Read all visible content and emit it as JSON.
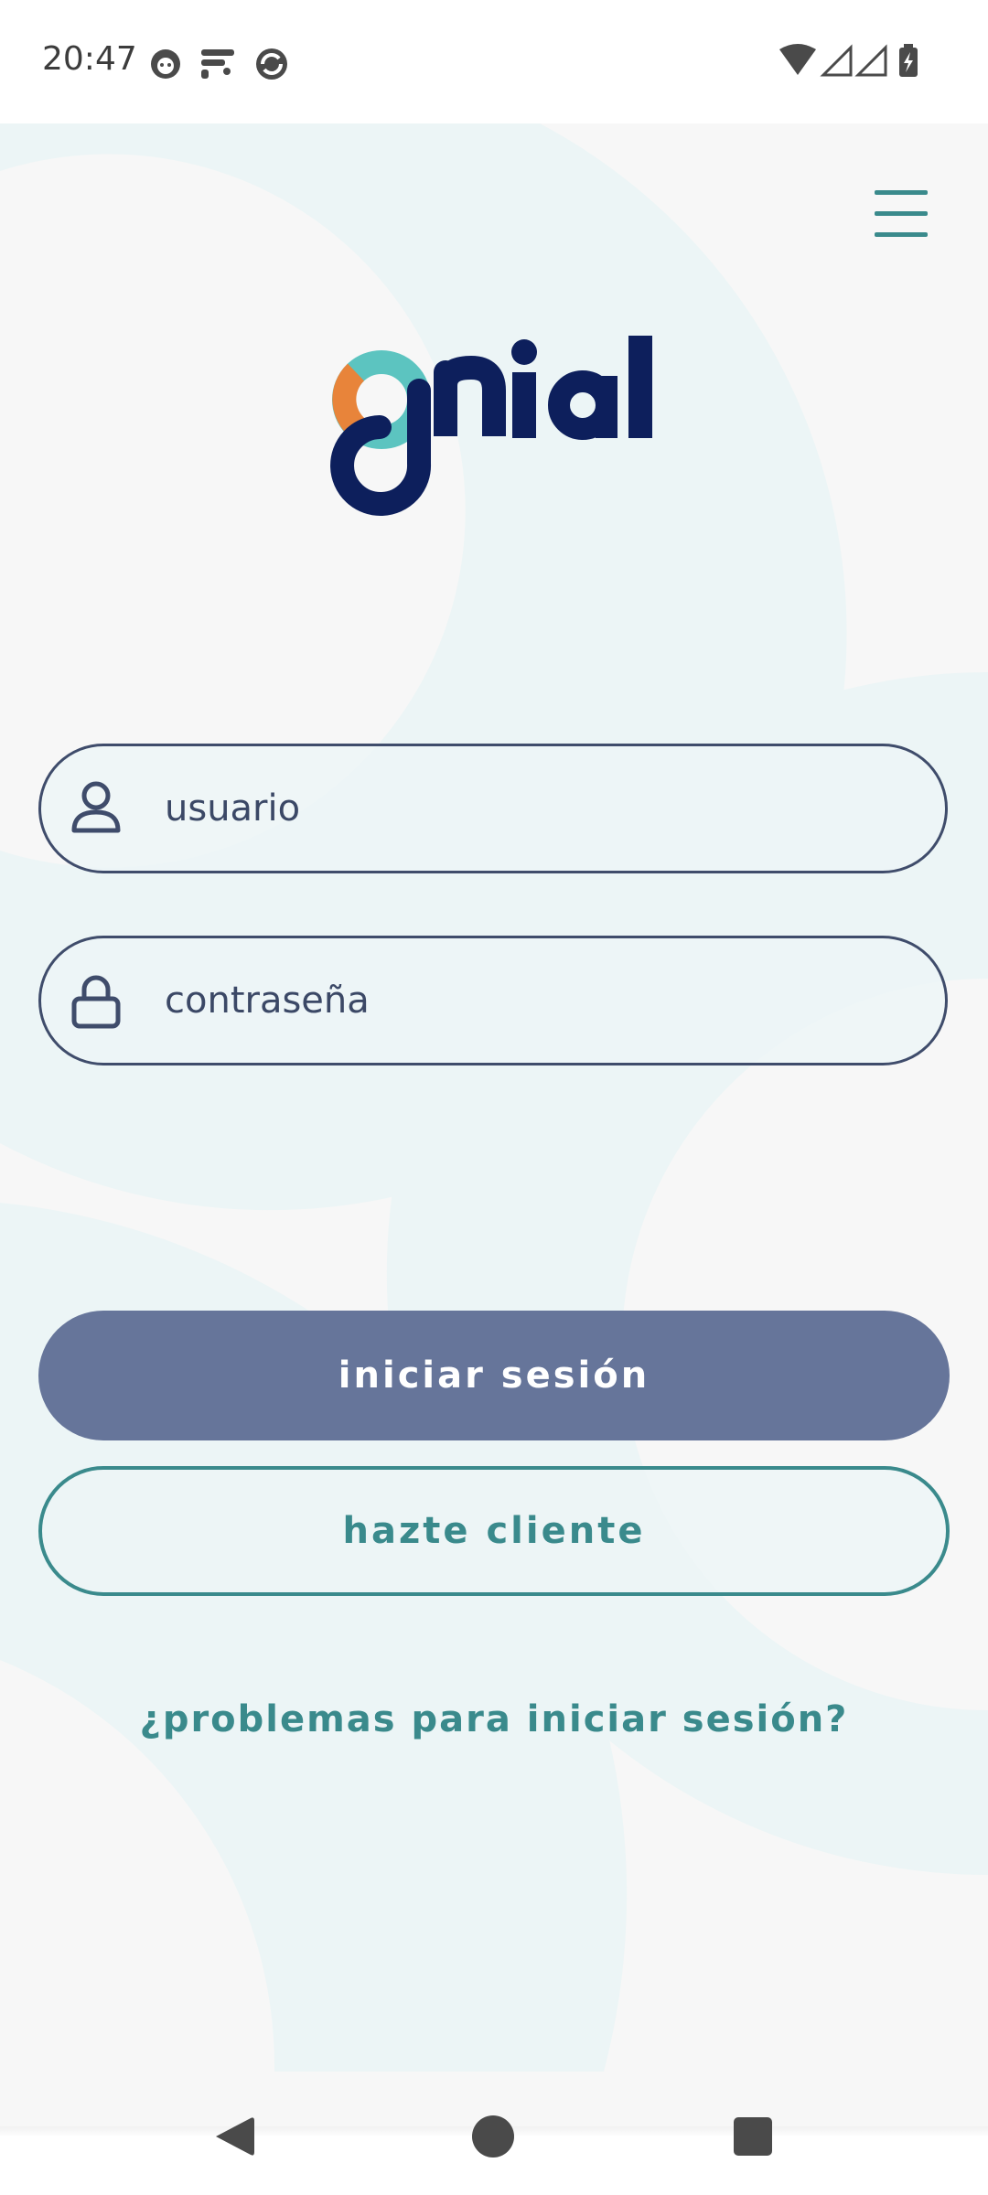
{
  "status_bar": {
    "time": "20:47",
    "left_icons": [
      "cat-notification-icon",
      "app-f-notification-icon",
      "sync-notification-icon"
    ],
    "right_icons": [
      "wifi-icon",
      "signal-icon",
      "signal-icon",
      "battery-charging-icon"
    ]
  },
  "header": {
    "menu_icon": "hamburger-menu-icon"
  },
  "logo": {
    "text": "gnial",
    "colors": {
      "navy": "#0d1f5c",
      "teal": "#5cc4c0",
      "orange": "#e8843a"
    }
  },
  "login_form": {
    "username": {
      "placeholder": "usuario",
      "icon": "user-icon"
    },
    "password": {
      "placeholder": "contraseña",
      "icon": "lock-icon"
    },
    "login_button": "iniciar sesión",
    "register_button": "hazte cliente",
    "help_link": "¿problemas para iniciar sesión?"
  },
  "theme": {
    "accent_teal": "#3a8a8c",
    "primary_button": "#66759a",
    "field_border": "#3f4c6b",
    "background": "#f7f7f7"
  },
  "nav_bar": {
    "buttons": [
      "back-icon",
      "home-icon",
      "recents-icon"
    ]
  }
}
